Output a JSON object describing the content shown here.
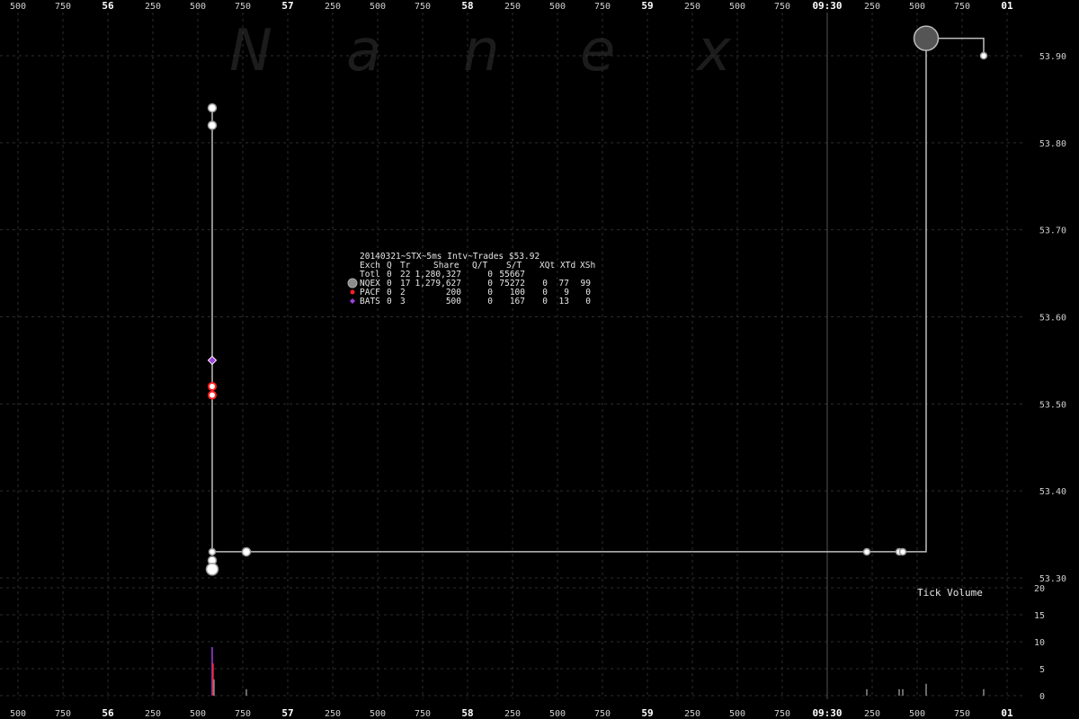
{
  "watermark": [
    "N",
    "a",
    "n",
    "e",
    "x"
  ],
  "colors": {
    "background": "#000000",
    "grid": "#2e2e2e",
    "price_line": "#bdbdbd",
    "NQEX": "#8c8c8c",
    "PACF": "#ff2020",
    "BATS": "#a040e0",
    "session_line": "#555555"
  },
  "chart_data": {
    "type": "scatter",
    "title": "20140321~STX~5ms Intv~Trades $53.92",
    "x_ticks": [
      {
        "label": "500",
        "major": false
      },
      {
        "label": "750",
        "major": false
      },
      {
        "label": "56",
        "major": true
      },
      {
        "label": "250",
        "major": false
      },
      {
        "label": "500",
        "major": false
      },
      {
        "label": "750",
        "major": false
      },
      {
        "label": "57",
        "major": true
      },
      {
        "label": "250",
        "major": false
      },
      {
        "label": "500",
        "major": false
      },
      {
        "label": "750",
        "major": false
      },
      {
        "label": "58",
        "major": true
      },
      {
        "label": "250",
        "major": false
      },
      {
        "label": "500",
        "major": false
      },
      {
        "label": "750",
        "major": false
      },
      {
        "label": "59",
        "major": true
      },
      {
        "label": "250",
        "major": false
      },
      {
        "label": "500",
        "major": false
      },
      {
        "label": "750",
        "major": false
      },
      {
        "label": "09:30",
        "major": true
      },
      {
        "label": "250",
        "major": false
      },
      {
        "label": "500",
        "major": false
      },
      {
        "label": "750",
        "major": false
      },
      {
        "label": "01",
        "major": true
      }
    ],
    "x_range": [
      -0.5,
      5.1
    ],
    "y_price": {
      "ticks": [
        "53.30",
        "53.40",
        "53.50",
        "53.60",
        "53.70",
        "53.80",
        "53.90"
      ],
      "range": [
        53.29,
        53.93
      ]
    },
    "y_volume": {
      "label": "Tick Volume",
      "ticks": [
        "0",
        "5",
        "10",
        "15",
        "20"
      ],
      "range": [
        0,
        20
      ]
    },
    "session_marker_x": 3.5,
    "price_path": [
      [
        0.08,
        53.84
      ],
      [
        0.08,
        53.82
      ],
      [
        0.08,
        53.55
      ],
      [
        0.08,
        53.52
      ],
      [
        0.08,
        53.51
      ],
      [
        0.08,
        53.33
      ],
      [
        0.27,
        53.33
      ],
      [
        3.72,
        53.33
      ],
      [
        3.9,
        53.33
      ],
      [
        3.92,
        53.33
      ],
      [
        4.05,
        53.33
      ],
      [
        4.05,
        53.92
      ],
      [
        4.37,
        53.92
      ],
      [
        4.37,
        53.9
      ]
    ],
    "trades": [
      {
        "ex": "NQEX",
        "x": 0.08,
        "y": 53.84,
        "size": 3
      },
      {
        "ex": "NQEX",
        "x": 0.08,
        "y": 53.82,
        "size": 3
      },
      {
        "ex": "BATS",
        "x": 0.08,
        "y": 53.55,
        "size": 3
      },
      {
        "ex": "PACF",
        "x": 0.08,
        "y": 53.52,
        "size": 2
      },
      {
        "ex": "PACF",
        "x": 0.08,
        "y": 53.51,
        "size": 2
      },
      {
        "ex": "NQEX",
        "x": 0.08,
        "y": 53.33,
        "size": 2
      },
      {
        "ex": "NQEX",
        "x": 0.08,
        "y": 53.32,
        "size": 3
      },
      {
        "ex": "NQEX",
        "x": 0.08,
        "y": 53.31,
        "size": 5
      },
      {
        "ex": "NQEX",
        "x": 0.27,
        "y": 53.33,
        "size": 3
      },
      {
        "ex": "NQEX",
        "x": 3.72,
        "y": 53.33,
        "size": 2
      },
      {
        "ex": "NQEX",
        "x": 3.9,
        "y": 53.33,
        "size": 2
      },
      {
        "ex": "NQEX",
        "x": 3.92,
        "y": 53.33,
        "size": 2
      },
      {
        "ex": "NQEX",
        "x": 4.05,
        "y": 53.92,
        "size": 12
      },
      {
        "ex": "NQEX",
        "x": 4.37,
        "y": 53.9,
        "size": 2
      }
    ],
    "volume_bars": [
      {
        "x": 0.08,
        "v": 9,
        "ex": "BATS"
      },
      {
        "x": 0.085,
        "v": 6,
        "ex": "PACF"
      },
      {
        "x": 0.09,
        "v": 3,
        "ex": "NQEX"
      },
      {
        "x": 0.27,
        "v": 1.2,
        "ex": "NQEX"
      },
      {
        "x": 3.72,
        "v": 1.2,
        "ex": "NQEX"
      },
      {
        "x": 3.9,
        "v": 1.2,
        "ex": "NQEX"
      },
      {
        "x": 3.92,
        "v": 1.2,
        "ex": "NQEX"
      },
      {
        "x": 4.05,
        "v": 2.2,
        "ex": "NQEX"
      },
      {
        "x": 4.37,
        "v": 1.2,
        "ex": "NQEX"
      }
    ],
    "legend": {
      "header": [
        "Exch",
        "Q",
        "Tr",
        "Share",
        "Q/T",
        "S/T",
        "XQt",
        "XTd",
        "XSh"
      ],
      "rows": [
        {
          "exch": "Totl",
          "q": "0",
          "tr": "22",
          "share": "1,280,327",
          "qt": "0",
          "st": "55667",
          "xqt": "",
          "xtd": "",
          "xsh": "",
          "icon": ""
        },
        {
          "exch": "NQEX",
          "q": "0",
          "tr": "17",
          "share": "1,279,627",
          "qt": "0",
          "st": "75272",
          "xqt": "0",
          "xtd": "77",
          "xsh": "99",
          "icon": "circle"
        },
        {
          "exch": "PACF",
          "q": "0",
          "tr": "2",
          "share": "200",
          "qt": "0",
          "st": "100",
          "xqt": "0",
          "xtd": "9",
          "xsh": "0",
          "icon": "dot"
        },
        {
          "exch": "BATS",
          "q": "0",
          "tr": "3",
          "share": "500",
          "qt": "0",
          "st": "167",
          "xqt": "0",
          "xtd": "13",
          "xsh": "0",
          "icon": "diamond"
        }
      ]
    }
  }
}
